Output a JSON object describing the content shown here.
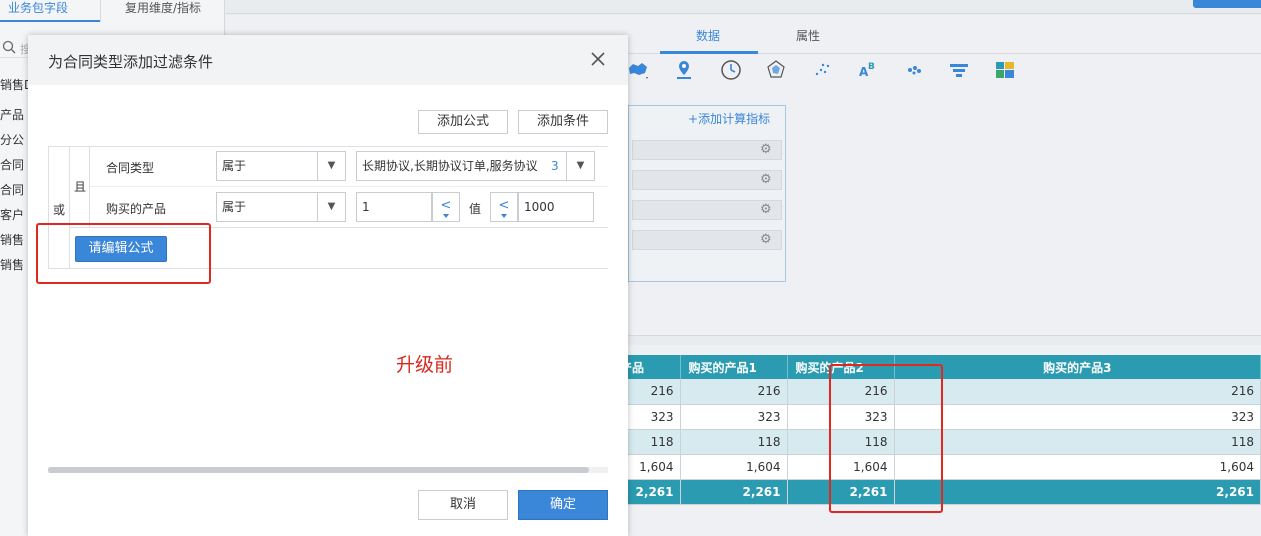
{
  "left_panel": {
    "tabs": [
      "业务包字段",
      "复用维度/指标"
    ],
    "search_placeholder": "搜",
    "items": [
      "销售D",
      "产品",
      "分公",
      "合同",
      "合同",
      "客户",
      "销售",
      "销售"
    ]
  },
  "main": {
    "tabs": [
      "数据",
      "属性"
    ],
    "add_metric_label": "添加计算指标",
    "chart_icons": [
      "map-filled-icon",
      "map-pin-icon",
      "clock-gauge-icon",
      "radar-icon",
      "scatter-icon",
      "word-cloud-icon",
      "dot-map-icon",
      "funnel-icon",
      "heatmap-icon"
    ]
  },
  "table": {
    "headers": [
      "的产品",
      "购买的产品1",
      "购买的产品2",
      "购买的产品3"
    ],
    "rows": [
      [
        "216",
        "216",
        "216",
        "216"
      ],
      [
        "323",
        "323",
        "323",
        "323"
      ],
      [
        "118",
        "118",
        "118",
        "118"
      ],
      [
        "1,604",
        "1,604",
        "1,604",
        "1,604"
      ]
    ],
    "total": [
      "2,261",
      "2,261",
      "2,261",
      "2,261"
    ]
  },
  "modal": {
    "title": "为合同类型添加过滤条件",
    "add_formula_label": "添加公式",
    "add_condition_label": "添加条件",
    "or_label": "或",
    "and_label": "且",
    "conditions": [
      {
        "field": "合同类型",
        "operator": "属于",
        "value": "长期协议,长期协议订单,服务协议",
        "count": "3"
      },
      {
        "field": "购买的产品",
        "operator": "属于",
        "min": "1",
        "value_label": "值",
        "max": "1000"
      }
    ],
    "edit_formula_label": "请编辑公式",
    "annotation": "升级前",
    "cancel_label": "取消",
    "ok_label": "确定"
  },
  "colors": {
    "accent": "#3a86d9",
    "table_header": "#2a9bb0",
    "annotation_red": "#e0281e"
  }
}
